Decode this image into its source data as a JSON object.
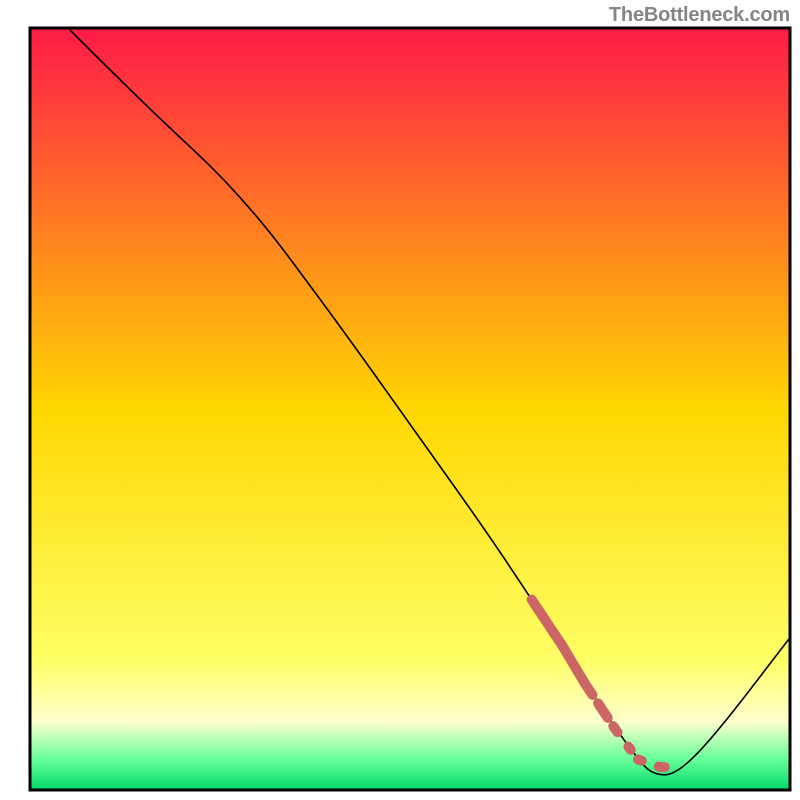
{
  "watermark": "TheBottleneck.com",
  "chart_data": {
    "type": "line",
    "title": "",
    "xlabel": "",
    "ylabel": "",
    "xlim": [
      0,
      100
    ],
    "ylim": [
      0,
      100
    ],
    "background": {
      "type": "vertical-gradient",
      "stops": [
        {
          "offset": 0.0,
          "color": "#ff1a47"
        },
        {
          "offset": 0.5,
          "color": "#ffd700"
        },
        {
          "offset": 0.83,
          "color": "#ffff66"
        },
        {
          "offset": 0.91,
          "color": "#ffffcc"
        },
        {
          "offset": 0.96,
          "color": "#66ff99"
        },
        {
          "offset": 1.0,
          "color": "#00d96b"
        }
      ]
    },
    "series": [
      {
        "name": "bottleneck-curve",
        "x": [
          5,
          15,
          28,
          40,
          50,
          60,
          66,
          70,
          75,
          80,
          82,
          85,
          90,
          100
        ],
        "y": [
          100,
          90,
          78,
          62,
          48,
          34,
          25,
          19,
          11,
          4,
          2,
          2,
          7,
          20
        ],
        "color": "#000000",
        "width": 1.6
      }
    ],
    "highlight": {
      "name": "good-zone",
      "x": [
        66,
        70,
        73,
        75,
        77,
        80,
        83,
        85
      ],
      "y": [
        25,
        19,
        14,
        11,
        8,
        4,
        3,
        3
      ],
      "color": "#cc6666",
      "style": "dotted"
    },
    "frame": {
      "color": "#000000",
      "width": 3
    }
  }
}
